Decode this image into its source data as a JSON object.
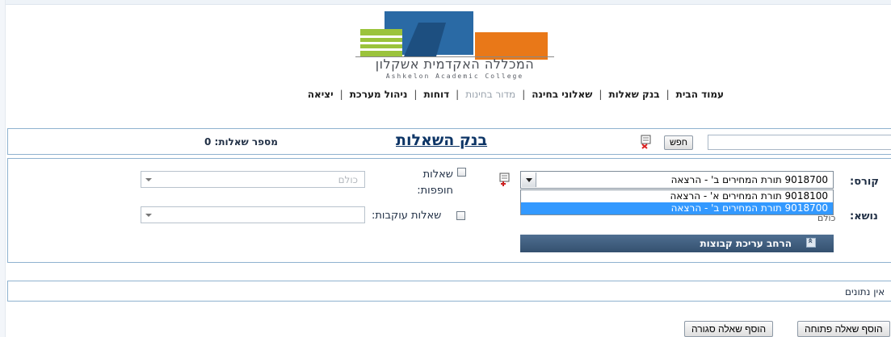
{
  "logo": {
    "name_hebrew": "המכללה האקדמית אשקלון",
    "name_english": "Ashkelon Academic College"
  },
  "nav": {
    "items": [
      {
        "label": "עמוד הבית",
        "enabled": true
      },
      {
        "label": "בנק שאלות",
        "enabled": true
      },
      {
        "label": "שאלוני בחינה",
        "enabled": true
      },
      {
        "label": "מדור בחינות",
        "enabled": false
      },
      {
        "label": "דוחות",
        "enabled": true
      },
      {
        "label": "ניהול מערכת",
        "enabled": true
      },
      {
        "label": "יציאה",
        "enabled": true
      }
    ]
  },
  "bank": {
    "title": "בנק השאלות",
    "count_label": "מספר שאלות: 0",
    "search_button": "חפש",
    "search_value": ""
  },
  "filters": {
    "course_label": "קורס:",
    "topic_label": "נושא:",
    "course_selected": "9018700 תורת המחירים ב' - הרצאה",
    "course_options": [
      "9018100 תורת המחירים א' - הרצאה",
      "9018700 תורת המחירים ב' - הרצאה"
    ],
    "topic_value_partial": "כולם",
    "optional_questions_label": "שאלות חופפות:",
    "following_questions_label": "שאלות עוקבות:",
    "combo1_value": "כולם",
    "combo2_value": "",
    "expand_groups_label": "הרחב עריכת קבוצות"
  },
  "data_panel": {
    "no_data_text": "אין נתונים"
  },
  "buttons": {
    "add_open": "הוסף שאלה פתוחה",
    "add_closed": "הוסף שאלה סגורה"
  },
  "colors": {
    "accent_title": "#0d3566",
    "panel_border": "#8fb2cf",
    "selected_option": "#3399ff",
    "expand_bar": "#3f5d7f"
  }
}
